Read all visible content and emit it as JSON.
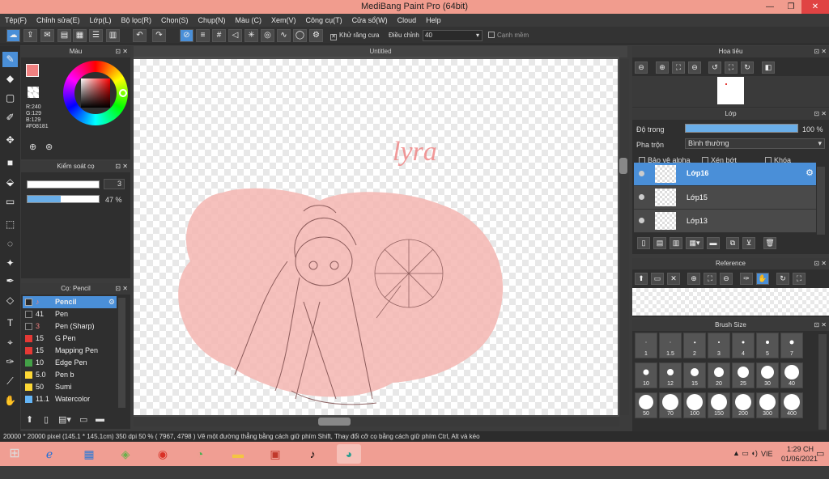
{
  "window": {
    "title": "MediBang Paint Pro (64bit)",
    "minimize": "—",
    "maximize": "❐",
    "close": "✕"
  },
  "menu": [
    "Tệp(F)",
    "Chỉnh sửa(E)",
    "Lớp(L)",
    "Bộ lọc(R)",
    "Chọn(S)",
    "Chụp(N)",
    "Màu (C)",
    "Xem(V)",
    "Công cụ(T)",
    "Cửa sổ(W)",
    "Cloud",
    "Help"
  ],
  "toolbar": {
    "antialias_label": "Khử răng cưa",
    "adjust_label": "Điều chỉnh",
    "adjust_value": "40",
    "edge_label": "Cạnh mềm"
  },
  "color_panel": {
    "title": "Màu",
    "r": "R:240",
    "g": "G:129",
    "b": "B:129",
    "hex": "#F08181",
    "accent": "#f08181"
  },
  "brush_control": {
    "title": "Kiểm soát cọ",
    "size_value": "3",
    "opacity_value": "47 %",
    "opacity_fraction": 0.47
  },
  "brush_list": {
    "title": "Cọ: Pencil",
    "items": [
      {
        "num": "",
        "name": "Pencil",
        "color": "#2a2a2a",
        "selected": true
      },
      {
        "num": "41",
        "name": "Pen",
        "color": "#2a2a2a"
      },
      {
        "num": "3",
        "name": "Pen (Sharp)",
        "color": "#2a2a2a"
      },
      {
        "num": "15",
        "name": "G Pen",
        "color": "#e53935"
      },
      {
        "num": "15",
        "name": "Mapping Pen",
        "color": "#e53935"
      },
      {
        "num": "10",
        "name": "Edge Pen",
        "color": "#43a047"
      },
      {
        "num": "5.0",
        "name": "Pen b",
        "color": "#fdd835"
      },
      {
        "num": "50",
        "name": "Sumi",
        "color": "#fdd835"
      },
      {
        "num": "11.1",
        "name": "Watercolor",
        "color": "#64b5f6"
      }
    ]
  },
  "canvas": {
    "tab_title": "Untitled",
    "signature_text": "lyra"
  },
  "navigator": {
    "title": "Hoa tiêu"
  },
  "layer_panel": {
    "title": "Lớp",
    "opacity_label": "Độ trong",
    "opacity_value": "100 %",
    "blend_label": "Pha trộn",
    "blend_value": "Bình thường",
    "protect_alpha": "Bảo vệ alpha",
    "clipping": "Xén bớt",
    "lock": "Khóa",
    "layers": [
      {
        "name": "Lớp16",
        "selected": true
      },
      {
        "name": "Lớp15"
      },
      {
        "name": "Lớp13"
      }
    ]
  },
  "reference": {
    "title": "Reference"
  },
  "brush_size": {
    "title": "Brush Size",
    "sizes": [
      "1",
      "1.5",
      "2",
      "3",
      "4",
      "5",
      "7",
      "10",
      "12",
      "15",
      "20",
      "25",
      "30",
      "40",
      "50",
      "70",
      "100",
      "150",
      "200",
      "300",
      "400"
    ]
  },
  "status": {
    "text": "20000 * 20000 pixel   (145.1 * 145.1cm)   350 dpi   50 %   ( 7967, 4798 )   Vẽ một đường thẳng bằng cách giữ phím Shift, Thay đổi cỡ cọ bằng cách giữ phím Ctrl, Alt và kéo"
  },
  "taskbar": {
    "lang": "VIE",
    "time": "1:29 CH",
    "date": "01/06/2021",
    "colors": {
      "bar": "#f09e93"
    }
  }
}
